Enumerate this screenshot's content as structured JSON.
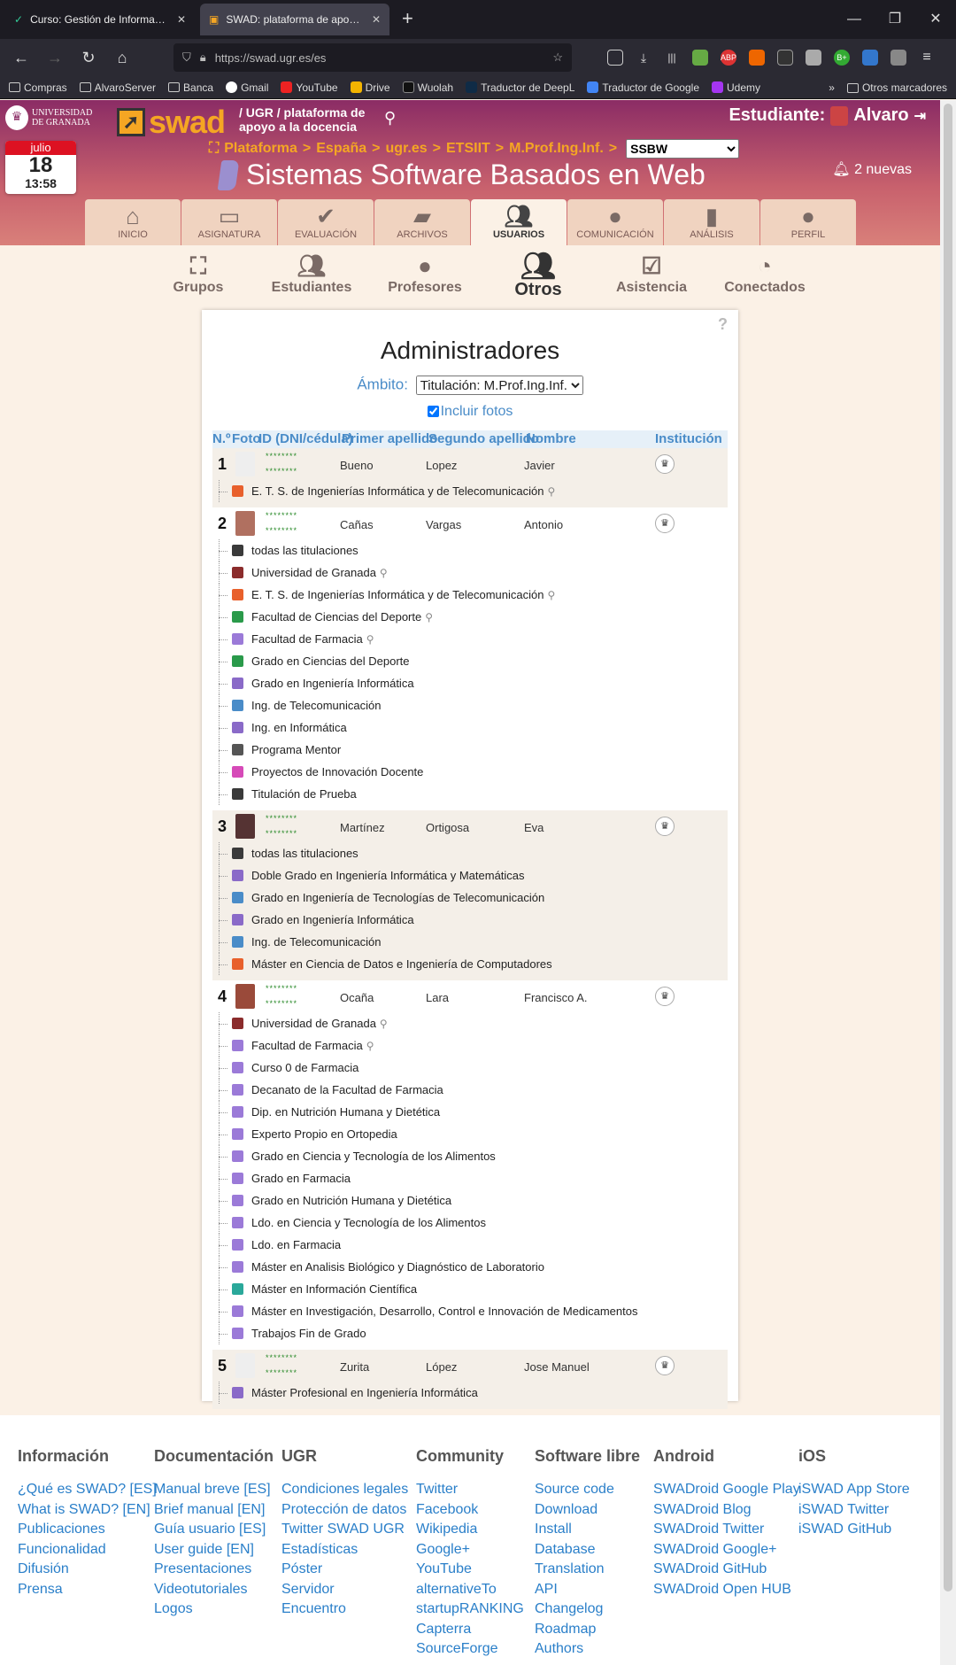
{
  "browser": {
    "tabs": [
      {
        "title": "Curso: Gestión de Información",
        "active": false
      },
      {
        "title": "SWAD: plataforma de apoyo a la docencia",
        "active": true
      }
    ],
    "url": "https://swad.ugr.es/es",
    "bookmarks": [
      "Compras",
      "AlvaroServer",
      "Banca",
      "Gmail",
      "YouTube",
      "Drive",
      "Wuolah",
      "Traductor de DeepL",
      "Traductor de Google",
      "Udemy"
    ],
    "other_bookmarks": "Otros marcadores"
  },
  "header": {
    "ugr_logo_line1": "UNIVERSIDAD",
    "ugr_logo_line2": "DE GRANADA",
    "swad_logo": "swad",
    "tagline": "/ UGR / plataforma de apoyo a la docencia",
    "user_role": "Estudiante:",
    "user_name": "Alvaro",
    "date": {
      "month": "julio",
      "day": "18",
      "time": "13:58"
    },
    "breadcrumb": [
      "Plataforma",
      "España",
      "ugr.es",
      "ETSIIT",
      "M.Prof.Ing.Inf."
    ],
    "breadcrumb_sep": ">",
    "course_select": "SSBW",
    "course_title": "Sistemas Software Basados en Web",
    "notifications": "2 nuevas"
  },
  "main_tabs": [
    {
      "label": "INICIO",
      "icon": "home-icon"
    },
    {
      "label": "ASIGNATURA",
      "icon": "chalkboard-icon"
    },
    {
      "label": "EVALUACIÓN",
      "icon": "check-icon"
    },
    {
      "label": "ARCHIVOS",
      "icon": "folder-icon"
    },
    {
      "label": "USUARIOS",
      "icon": "users-icon",
      "active": true
    },
    {
      "label": "COMUNICACIÓN",
      "icon": "chat-icon"
    },
    {
      "label": "ANÁLISIS",
      "icon": "chart-icon"
    },
    {
      "label": "PERFIL",
      "icon": "user-icon"
    }
  ],
  "sub_tabs": [
    {
      "label": "Grupos",
      "icon": "sitemap-icon"
    },
    {
      "label": "Estudiantes",
      "icon": "users-icon"
    },
    {
      "label": "Profesores",
      "icon": "teacher-icon"
    },
    {
      "label": "Otros",
      "icon": "user-friends-icon",
      "active": true
    },
    {
      "label": "Asistencia",
      "icon": "calendar-check-icon"
    },
    {
      "label": "Conectados",
      "icon": "user-clock-icon"
    }
  ],
  "panel": {
    "help": "?",
    "title": "Administradores",
    "scope_label": "Ámbito:",
    "scope_value": "Titulación: M.Prof.Ing.Inf.",
    "include_photos": "Incluir fotos",
    "columns": [
      "N.º",
      "Foto",
      "ID (DNI/cédula)",
      "Primer apellido",
      "Segundo apellido",
      "Nombre",
      "Institución"
    ]
  },
  "users": [
    {
      "num": "1",
      "id1": "********",
      "id2": "********",
      "surname1": "Bueno",
      "surname2": "Lopez",
      "name": "Javier",
      "photo_color": "#eeeeee",
      "institutions": [
        {
          "name": "E. T. S. de Ingenierías Informática y de Telecomunicación",
          "icon_color": "#e8602c",
          "pin": true
        }
      ]
    },
    {
      "num": "2",
      "id1": "********",
      "id2": "********",
      "surname1": "Cañas",
      "surname2": "Vargas",
      "name": "Antonio",
      "photo_color": "#b07060",
      "institutions": [
        {
          "name": "todas las titulaciones",
          "icon_color": "#3a3a3a"
        },
        {
          "name": "Universidad de Granada",
          "icon_color": "#8b2c2c",
          "pin": true
        },
        {
          "name": "E. T. S. de Ingenierías Informática y de Telecomunicación",
          "icon_color": "#e8602c",
          "pin": true
        },
        {
          "name": "Facultad de Ciencias del Deporte",
          "icon_color": "#2a9a4a",
          "pin": true
        },
        {
          "name": "Facultad de Farmacia",
          "icon_color": "#9b7ad8",
          "pin": true
        },
        {
          "name": "Grado en Ciencias del Deporte",
          "icon_color": "#2a9a4a"
        },
        {
          "name": "Grado en Ingeniería Informática",
          "icon_color": "#8a6ac8"
        },
        {
          "name": "Ing. de Telecomunicación",
          "icon_color": "#4a8cc8"
        },
        {
          "name": "Ing. en Informática",
          "icon_color": "#8a6ac8"
        },
        {
          "name": "Programa Mentor",
          "icon_color": "#555555"
        },
        {
          "name": "Proyectos de Innovación Docente",
          "icon_color": "#d64ab8"
        },
        {
          "name": "Titulación de Prueba",
          "icon_color": "#3a3a3a"
        }
      ]
    },
    {
      "num": "3",
      "id1": "********",
      "id2": "********",
      "surname1": "Martínez",
      "surname2": "Ortigosa",
      "name": "Eva",
      "photo_color": "#553333",
      "institutions": [
        {
          "name": "todas las titulaciones",
          "icon_color": "#3a3a3a"
        },
        {
          "name": "Doble Grado en Ingeniería Informática y Matemáticas",
          "icon_color": "#8a6ac8"
        },
        {
          "name": "Grado en Ingeniería de Tecnologías de Telecomunicación",
          "icon_color": "#4a8cc8"
        },
        {
          "name": "Grado en Ingeniería Informática",
          "icon_color": "#8a6ac8"
        },
        {
          "name": "Ing. de Telecomunicación",
          "icon_color": "#4a8cc8"
        },
        {
          "name": "Máster en Ciencia de Datos e Ingeniería de Computadores",
          "icon_color": "#e8602c"
        }
      ]
    },
    {
      "num": "4",
      "id1": "********",
      "id2": "********",
      "surname1": "Ocaña",
      "surname2": "Lara",
      "name": "Francisco A.",
      "photo_color": "#9a4a3a",
      "institutions": [
        {
          "name": "Universidad de Granada",
          "icon_color": "#8b2c2c",
          "pin": true
        },
        {
          "name": "Facultad de Farmacia",
          "icon_color": "#9b7ad8",
          "pin": true
        },
        {
          "name": "Curso 0 de Farmacia",
          "icon_color": "#9b7ad8"
        },
        {
          "name": "Decanato de la Facultad de Farmacia",
          "icon_color": "#9b7ad8"
        },
        {
          "name": "Dip. en Nutrición Humana y Dietética",
          "icon_color": "#9b7ad8"
        },
        {
          "name": "Experto Propio en Ortopedia",
          "icon_color": "#9b7ad8"
        },
        {
          "name": "Grado en Ciencia y Tecnología de los Alimentos",
          "icon_color": "#9b7ad8"
        },
        {
          "name": "Grado en Farmacia",
          "icon_color": "#9b7ad8"
        },
        {
          "name": "Grado en Nutrición Humana y Dietética",
          "icon_color": "#9b7ad8"
        },
        {
          "name": "Ldo. en Ciencia y Tecnología de los Alimentos",
          "icon_color": "#9b7ad8"
        },
        {
          "name": "Ldo. en Farmacia",
          "icon_color": "#9b7ad8"
        },
        {
          "name": "Máster en Analisis Biológico y Diagnóstico de Laboratorio",
          "icon_color": "#9b7ad8"
        },
        {
          "name": "Máster en Información Científica",
          "icon_color": "#2aa89a"
        },
        {
          "name": "Máster en Investigación, Desarrollo, Control e Innovación de Medicamentos",
          "icon_color": "#9b7ad8"
        },
        {
          "name": "Trabajos Fin de Grado",
          "icon_color": "#9b7ad8"
        }
      ]
    },
    {
      "num": "5",
      "id1": "********",
      "id2": "********",
      "surname1": "Zurita",
      "surname2": "López",
      "name": "Jose Manuel",
      "photo_color": "#eeeeee",
      "institutions": [
        {
          "name": "Máster Profesional en Ingeniería Informática",
          "icon_color": "#8a6ac8"
        }
      ]
    }
  ],
  "footer": [
    {
      "heading": "Información",
      "links": [
        "¿Qué es SWAD? [ES]",
        "What is SWAD? [EN]",
        "Publicaciones",
        "Funcionalidad",
        "Difusión",
        "Prensa"
      ]
    },
    {
      "heading": "Documentación",
      "links": [
        "Manual breve [ES]",
        "Brief manual [EN]",
        "Guía usuario [ES]",
        "User guide [EN]",
        "Presentaciones",
        "Videotutoriales",
        "Logos"
      ]
    },
    {
      "heading": "UGR",
      "links": [
        "Condiciones legales",
        "Protección de datos",
        "Twitter SWAD UGR",
        "Estadísticas",
        "Póster",
        "Servidor",
        "Encuentro"
      ]
    },
    {
      "heading": "Community",
      "links": [
        "Twitter",
        "Facebook",
        "Wikipedia",
        "Google+",
        "YouTube",
        "alternativeTo",
        "startupRANKING",
        "Capterra",
        "SourceForge"
      ]
    },
    {
      "heading": "Software libre",
      "links": [
        "Source code",
        "Download",
        "Install",
        "Database",
        "Translation",
        "API",
        "Changelog",
        "Roadmap",
        "Authors"
      ]
    },
    {
      "heading": "Android",
      "links": [
        "SWADroid Google Play",
        "SWADroid Blog",
        "SWADroid Twitter",
        "SWADroid Google+",
        "SWADroid GitHub",
        "SWADroid Open HUB"
      ]
    },
    {
      "heading": "iOS",
      "links": [
        "iSWAD App Store",
        "iSWAD Twitter",
        "iSWAD GitHub"
      ]
    }
  ]
}
